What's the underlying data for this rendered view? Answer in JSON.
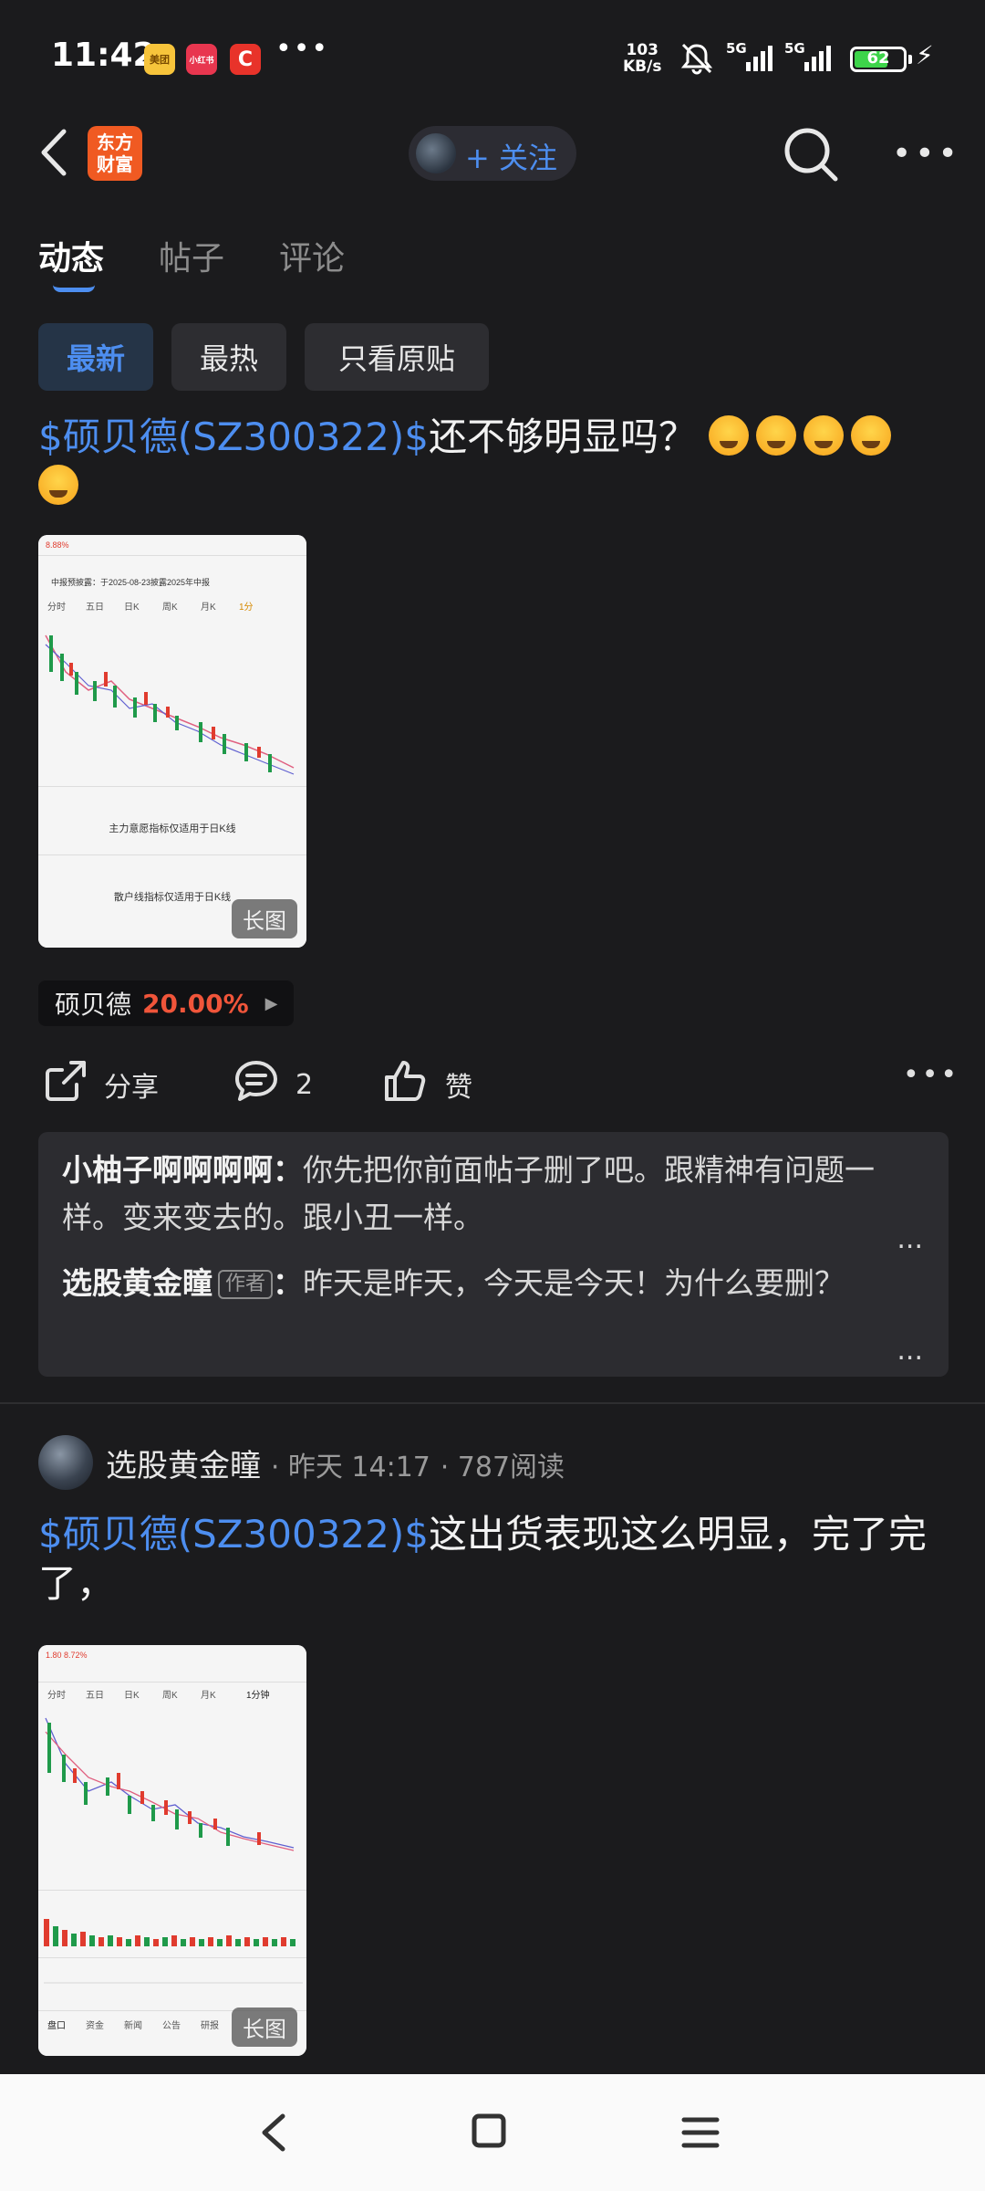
{
  "status_bar": {
    "time": "11:42",
    "apps": [
      "美团",
      "小红书",
      "C"
    ],
    "more": "•••",
    "net_speed_value": "103",
    "net_speed_unit": "KB/s",
    "signal1_label": "5G",
    "signal2_label": "5G",
    "battery": "62"
  },
  "header": {
    "logo_line1": "东方",
    "logo_line2": "财富",
    "follow_label": "+ 关注"
  },
  "tabs": [
    {
      "label": "动态",
      "active": true
    },
    {
      "label": "帖子",
      "active": false
    },
    {
      "label": "评论",
      "active": false
    }
  ],
  "filters": [
    {
      "label": "最新",
      "active": true
    },
    {
      "label": "最热",
      "active": false
    },
    {
      "label": "只看原贴",
      "active": false
    }
  ],
  "post1": {
    "stock_link": "$硕贝德(SZ300322)$",
    "text": "还不够明显吗？",
    "image_badge": "长图",
    "stock_tag_name": "硕贝德",
    "stock_tag_pct": "20.00%",
    "share_label": "分享",
    "comment_count": "2",
    "like_label": "赞",
    "comments": [
      {
        "author": "小柚子啊啊啊啊",
        "text": "你先把你前面帖子删了吧。跟精神有问题一样。变来变去的。跟小丑一样。",
        "is_author": false
      },
      {
        "author": "选股黄金瞳",
        "badge": "作者",
        "text": "昨天是昨天，今天是今天！为什么要删？",
        "is_author": true
      }
    ]
  },
  "post2": {
    "author": "选股黄金瞳",
    "time": "昨天 14:17",
    "reads": "787阅读",
    "stock_link": "$硕贝德(SZ300322)$",
    "text": "这出货表现这么明显，完了完了，",
    "image_badge": "长图"
  },
  "thumb1": {
    "top_left": "8.88%",
    "header_line": "中报预披露：于2025-08-23披露2025年中报",
    "tabs": [
      "分时",
      "五日",
      "日K",
      "周K",
      "月K",
      "1分"
    ],
    "indicator1": "主力意愿指标仅适用于日K线",
    "indicator2": "散户线指标仅适用于日K线"
  },
  "thumb2": {
    "top_left": "1.80  8.72%",
    "tabs": [
      "分时",
      "五日",
      "日K",
      "周K",
      "月K",
      "1分钟"
    ],
    "bottom_tabs": [
      "盘口",
      "资金",
      "新闻",
      "公告",
      "研报"
    ]
  }
}
